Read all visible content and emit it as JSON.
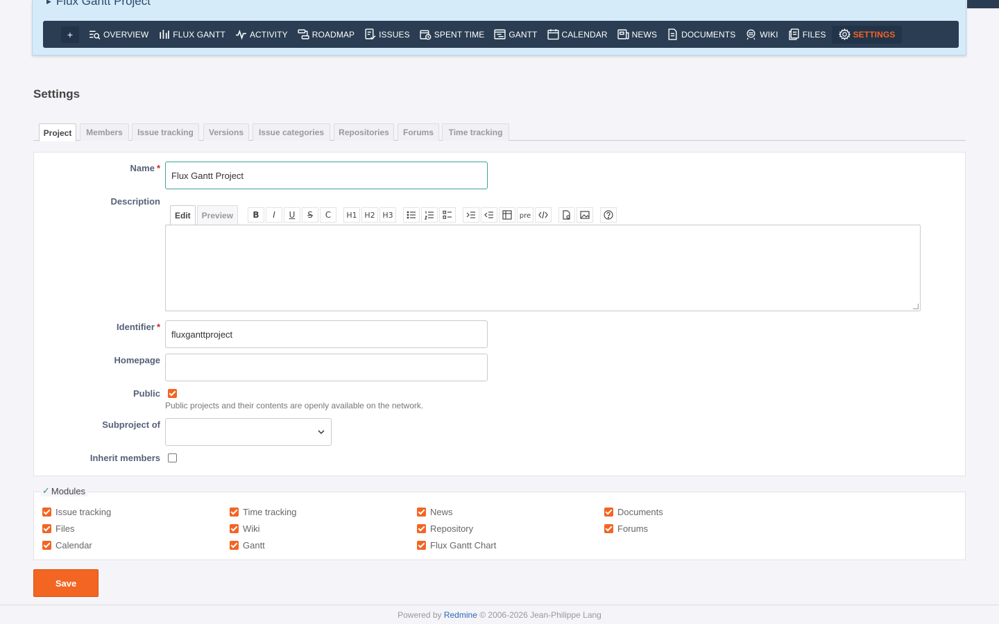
{
  "header": {
    "project_title": "Flux Gantt Project",
    "plus_label": "+",
    "menu": [
      {
        "label": "OVERVIEW",
        "icon": "overview-icon"
      },
      {
        "label": "FLUX GANTT",
        "icon": "bar-chart-icon"
      },
      {
        "label": "ACTIVITY",
        "icon": "activity-icon"
      },
      {
        "label": "ROADMAP",
        "icon": "roadmap-icon"
      },
      {
        "label": "ISSUES",
        "icon": "issues-icon"
      },
      {
        "label": "SPENT TIME",
        "icon": "time-icon"
      },
      {
        "label": "GANTT",
        "icon": "gantt-icon"
      },
      {
        "label": "CALENDAR",
        "icon": "calendar-icon"
      },
      {
        "label": "NEWS",
        "icon": "news-icon"
      },
      {
        "label": "DOCUMENTS",
        "icon": "documents-icon"
      },
      {
        "label": "WIKI",
        "icon": "wiki-icon"
      },
      {
        "label": "FILES",
        "icon": "files-icon"
      },
      {
        "label": "SETTINGS",
        "icon": "gear-icon"
      }
    ]
  },
  "page": {
    "title": "Settings"
  },
  "tabs": [
    "Project",
    "Members",
    "Issue tracking",
    "Versions",
    "Issue categories",
    "Repositories",
    "Forums",
    "Time tracking"
  ],
  "form": {
    "name_label": "Name",
    "name_value": "Flux Gantt Project",
    "required_mark": "*",
    "description_label": "Description",
    "edit_tab": "Edit",
    "preview_tab": "Preview",
    "toolbar": {
      "bold": "B",
      "italic": "I",
      "underline": "U",
      "strike": "S",
      "code": "C",
      "h1": "H1",
      "h2": "H2",
      "h3": "H3",
      "pre": "pre"
    },
    "identifier_label": "Identifier",
    "identifier_value": "fluxganttproject",
    "homepage_label": "Homepage",
    "homepage_value": "",
    "public_label": "Public",
    "public_checked": true,
    "public_hint": "Public projects and their contents are openly available on the network.",
    "subproject_label": "Subproject of",
    "subproject_value": "",
    "inherit_label": "Inherit members",
    "inherit_checked": false
  },
  "modules": {
    "legend": "Modules",
    "items": [
      {
        "label": "Issue tracking",
        "checked": true
      },
      {
        "label": "Time tracking",
        "checked": true
      },
      {
        "label": "News",
        "checked": true
      },
      {
        "label": "Documents",
        "checked": true
      },
      {
        "label": "Files",
        "checked": true
      },
      {
        "label": "Wiki",
        "checked": true
      },
      {
        "label": "Repository",
        "checked": true
      },
      {
        "label": "Forums",
        "checked": true
      },
      {
        "label": "Calendar",
        "checked": true
      },
      {
        "label": "Gantt",
        "checked": true
      },
      {
        "label": "Flux Gantt Chart",
        "checked": true
      }
    ]
  },
  "save_label": "Save",
  "footer": {
    "powered": "Powered by",
    "link": "Redmine",
    "copyright": "© 2006-2026 Jean-Philippe Lang"
  },
  "colors": {
    "accent": "#f26522",
    "menu_bg": "#2a3d52",
    "header_bg": "#d6ebf9"
  }
}
